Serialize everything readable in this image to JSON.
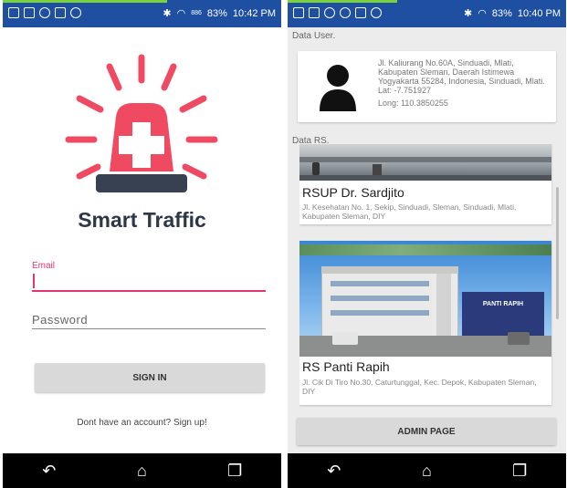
{
  "left_screen": {
    "status_bar": {
      "time": "10:42 PM",
      "battery": "83%",
      "network_speed": "886"
    },
    "app_name": "Smart Traffic",
    "email_label": "Email",
    "password_placeholder": "Password",
    "sign_in_label": "SIGN IN",
    "signup_text": "Dont have an account? Sign up!",
    "brand_color": "#ef4a62",
    "accent_color": "#e63470"
  },
  "right_screen": {
    "status_bar": {
      "time": "10:40 PM",
      "battery": "83%"
    },
    "user_section_label": "Data User.",
    "user": {
      "address": "Jl. Kaliurang No.60A, Sinduadi, Mlati, Kabupaten Sleman, Daerah Istimewa Yogyakarta 55284, Indonesia, Sinduadi, Mlati.",
      "lat": "Lat: -7.751927",
      "long": "Long: 110.3850255"
    },
    "rs_section_label": "Data RS.",
    "hospitals": [
      {
        "name": "RSUP Dr. Sardjito",
        "address": "Jl. Kesehatan No. 1, Sekip, Sinduadi, Sleman, Sinduadi, Mlati, Kabupaten Sleman, DIY"
      },
      {
        "name": "RS Panti Rapih",
        "address": "Jl. Cik Di Tiro No.30, Caturtunggal, Kec. Depok, Kabupaten Sleman, DIY",
        "sign_text": "PANTI RAPIH"
      }
    ],
    "admin_label": "ADMIN PAGE"
  }
}
